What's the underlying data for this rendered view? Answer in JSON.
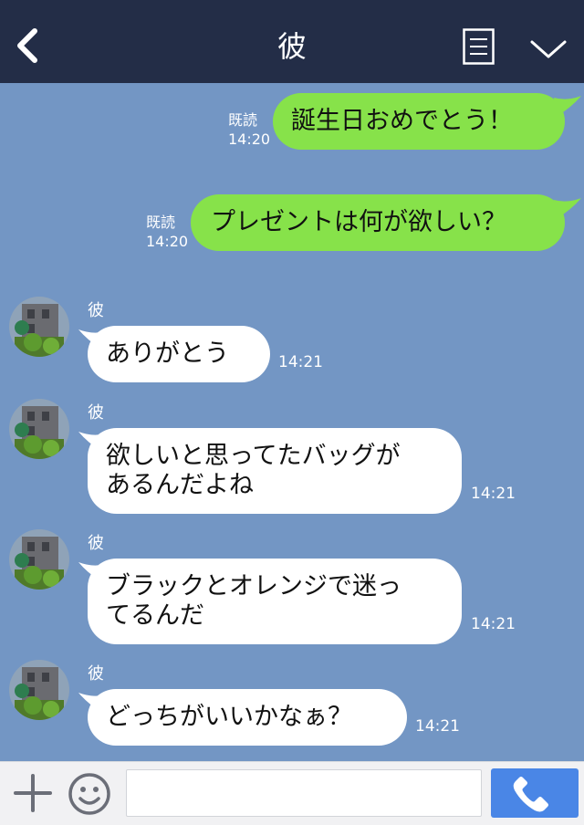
{
  "header": {
    "title": "彼"
  },
  "messages": [
    {
      "side": "sent",
      "lines": "誕生日おめでとう！",
      "read": "既読",
      "time": "14:20"
    },
    {
      "side": "sent",
      "lines": "プレゼントは何が欲しい？",
      "read": "既読",
      "time": "14:20"
    },
    {
      "side": "recv",
      "sender": "彼",
      "lines": "ありがとう",
      "time": "14:21"
    },
    {
      "side": "recv",
      "sender": "彼",
      "lines": "欲しいと思ってたバッグが\nあるんだよね",
      "time": "14:21"
    },
    {
      "side": "recv",
      "sender": "彼",
      "lines": "ブラックとオレンジで迷っ\nてるんだ",
      "time": "14:21"
    },
    {
      "side": "recv",
      "sender": "彼",
      "lines": "どっちがいいかなぁ？",
      "time": "14:21"
    }
  ],
  "input": {
    "placeholder": "",
    "value": ""
  },
  "colors": {
    "header": "#232d47",
    "background": "#7396c4",
    "sent_bubble": "#87e24a",
    "recv_bubble": "#ffffff",
    "call_button": "#4a86e6"
  },
  "icons": {
    "back": "chevron-left-icon",
    "menu": "menu-list-icon",
    "collapse": "chevron-down-icon",
    "plus": "plus-icon",
    "emoji": "smiley-icon",
    "call": "phone-icon"
  }
}
